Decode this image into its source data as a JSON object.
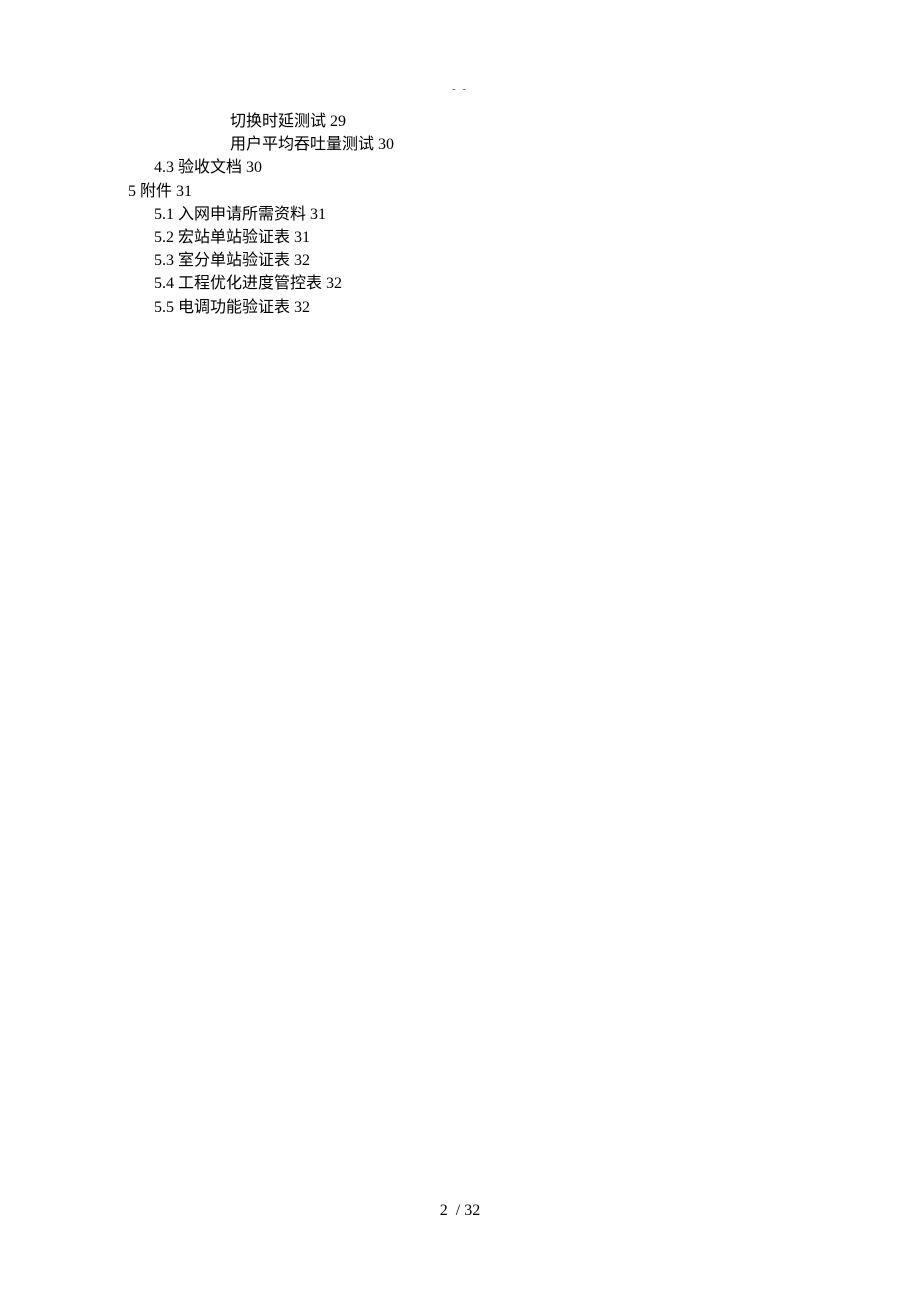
{
  "header_mark": "- -",
  "toc": {
    "deep_items": [
      {
        "text": "切换时延测试",
        "page": "29"
      },
      {
        "text": "用户平均吞吐量测试",
        "page": "30"
      }
    ],
    "item_4_3": {
      "num": "4.3",
      "text": "验收文档",
      "page": "30"
    },
    "section_5": {
      "num": "5",
      "text": "附件",
      "page": "31"
    },
    "section_5_items": [
      {
        "num": "5.1",
        "text": "入网申请所需资料",
        "page": "31"
      },
      {
        "num": "5.2",
        "text": "宏站单站验证表",
        "page": "31"
      },
      {
        "num": "5.3",
        "text": "室分单站验证表",
        "page": "32"
      },
      {
        "num": "5.4",
        "text": "工程优化进度管控表",
        "page": "32"
      },
      {
        "num": "5.5",
        "text": "电调功能验证表",
        "page": "32"
      }
    ]
  },
  "footer": {
    "current": "2",
    "sep": "/",
    "total": "32"
  }
}
